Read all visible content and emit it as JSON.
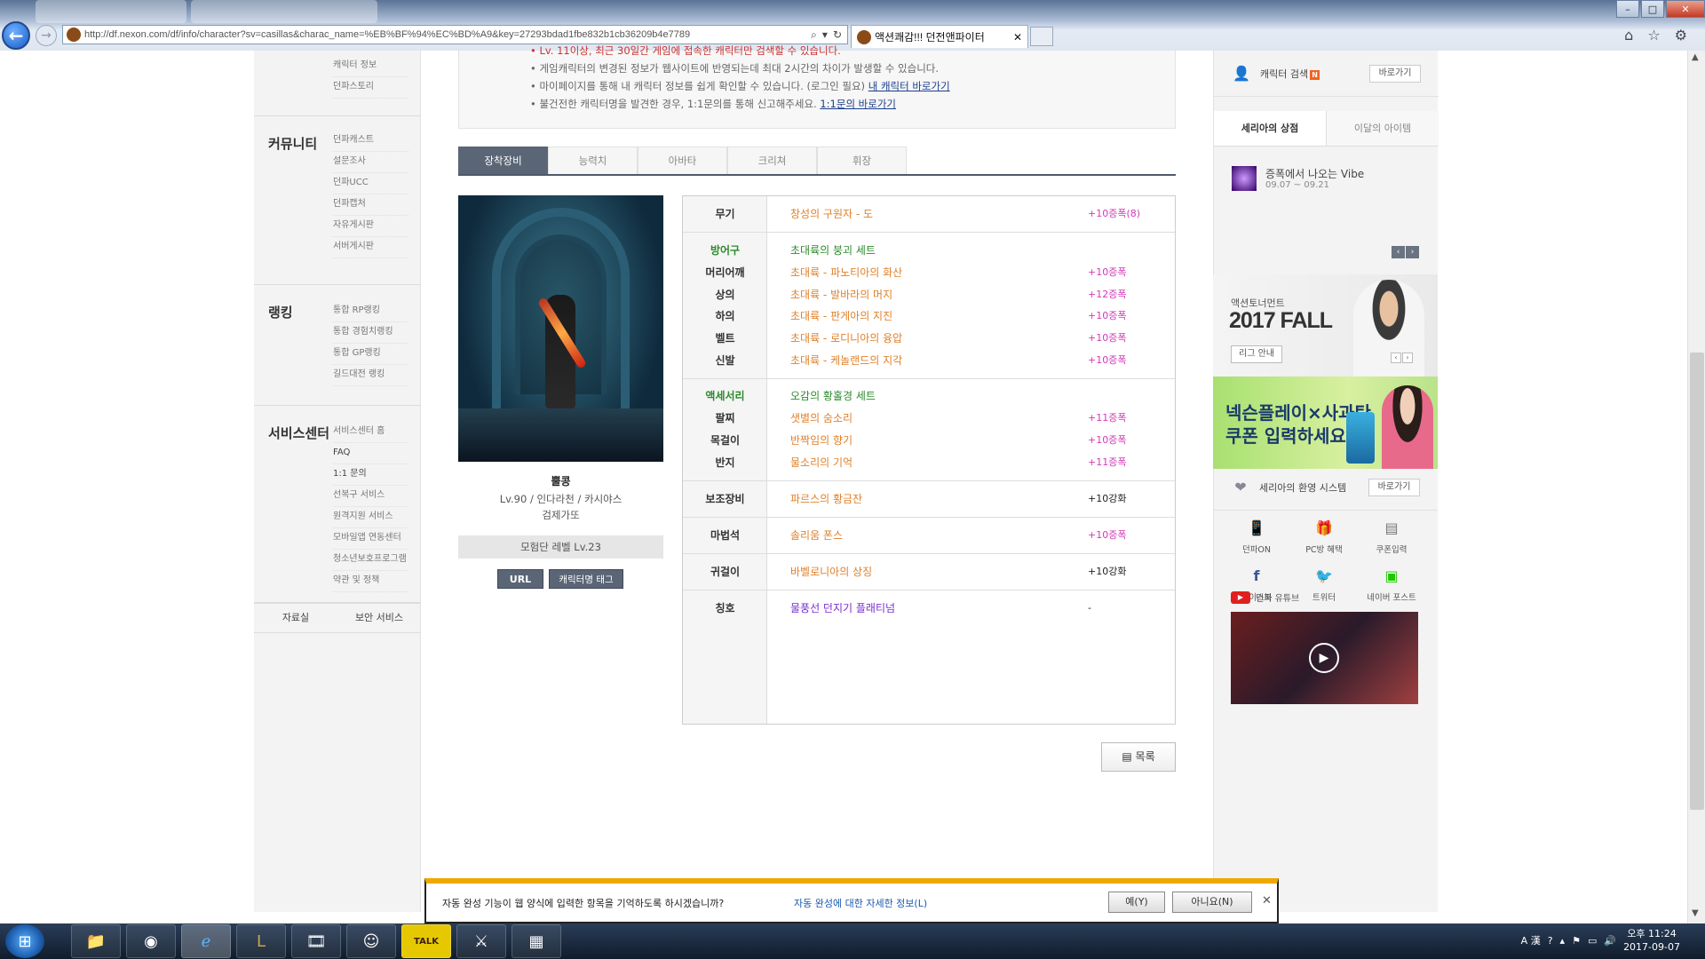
{
  "browser": {
    "url": "http://df.nexon.com/df/info/character?sv=casillas&charac_name=%EB%BF%94%EC%BD%A9&key=27293bdad1fbe832b1cb36209b4e7789",
    "tab_title": "액션쾌감!!! 던전앤파이터"
  },
  "lnb": {
    "top_links": [
      "캐릭터 정보",
      "던파스토리"
    ],
    "community": {
      "title": "커뮤니티",
      "links": [
        "던파캐스트",
        "설문조사",
        "던파UCC",
        "던파캡처",
        "자유게시판",
        "서버게시판"
      ]
    },
    "ranking": {
      "title": "랭킹",
      "links": [
        "통합 RP랭킹",
        "통합 경험치랭킹",
        "통합 GP랭킹",
        "길드대전 랭킹"
      ]
    },
    "service": {
      "title": "서비스센터",
      "links": [
        "서비스센터 홈",
        "FAQ",
        "1:1 문의",
        "선복구 서비스",
        "원격지원 서비스",
        "모바일앱 연동센터",
        "청소년보호프로그램",
        "약관 및 정책"
      ]
    },
    "bottom": [
      "자료실",
      "보안 서비스"
    ]
  },
  "notice": {
    "line0": "Lv. 11이상, 최근 30일간 게임에 접속한 캐릭터만 검색할 수 있습니다.",
    "line1": "게임캐릭터의 변경된 정보가 웹사이트에 반영되는데 최대 2시간의 차이가 발생할 수 있습니다.",
    "line2_text": "마이페이지를 통해 내 캐릭터 정보를 쉽게 확인할 수 있습니다. (로그인 필요)",
    "line2_link": "내 캐릭터 바로가기",
    "line3_text": "불건전한 캐릭터명을 발견한 경우, 1:1문의를 통해 신고해주세요.",
    "line3_link": "1:1문의 바로가기"
  },
  "tabs": [
    "장착장비",
    "능력치",
    "아바타",
    "크리쳐",
    "휘장"
  ],
  "character": {
    "name": "뿔콩",
    "info": "Lv.90 / 인다라천 / 카시야스",
    "guild": "검제가또",
    "adventure_level": "모험단 레벨 Lv.23",
    "url_button": "URL",
    "tag_button": "캐릭터명 태그"
  },
  "equipment": {
    "weapon": {
      "slot": "무기",
      "item": "창성의 구원자 - 도",
      "reinforce": "+10증폭(8)"
    },
    "armor_set": {
      "slot": "방어구",
      "item": "초대륙의 붕괴 세트"
    },
    "armor": [
      {
        "slot": "머리어깨",
        "item": "초대륙 - 파노티아의 화산",
        "reinforce": "+10증폭"
      },
      {
        "slot": "상의",
        "item": "초대륙 - 발바라의 머지",
        "reinforce": "+12증폭"
      },
      {
        "slot": "하의",
        "item": "초대륙 - 판게아의 지진",
        "reinforce": "+10증폭"
      },
      {
        "slot": "벨트",
        "item": "초대륙 - 로디니아의 융압",
        "reinforce": "+10증폭"
      },
      {
        "slot": "신발",
        "item": "초대륙 - 케놀랜드의 지각",
        "reinforce": "+10증폭"
      }
    ],
    "accessory_set": {
      "slot": "액세서리",
      "item": "오감의 황홀경 세트"
    },
    "accessories": [
      {
        "slot": "팔찌",
        "item": "샛별의 숨소리",
        "reinforce": "+11증폭"
      },
      {
        "slot": "목걸이",
        "item": "반짝임의 향기",
        "reinforce": "+10증폭"
      },
      {
        "slot": "반지",
        "item": "물소리의 기억",
        "reinforce": "+11증폭"
      }
    ],
    "sub": {
      "slot": "보조장비",
      "item": "파르스의 황금잔",
      "reinforce": "+10강화"
    },
    "stone": {
      "slot": "마법석",
      "item": "솔리움 폰스",
      "reinforce": "+10증폭"
    },
    "earring": {
      "slot": "귀걸이",
      "item": "바벨로니아의 상징",
      "reinforce": "+10강화"
    },
    "title": {
      "slot": "칭호",
      "item": "물풍선 던지기 플래티넘",
      "reinforce": "-"
    }
  },
  "list_button": "목록",
  "sidebar": {
    "char_search": "캐릭터 검색",
    "go": "바로가기",
    "shop_tabs": [
      "세리아의 상점",
      "이달의 아이템"
    ],
    "shop_item_name": "증폭에서 나오는 Vibe",
    "shop_item_date": "09.07 ~ 09.21",
    "banner1_small": "액션토너먼트",
    "banner1_big": "2017 FALL",
    "banner1_btn": "리그 안내",
    "banner2_line1": "넥슨플레이×사과탄",
    "banner2_line2": "쿠폰 입력하세요!",
    "seria_system": "세리아의 환영 시스템",
    "quick": [
      "던파ON",
      "PC방 혜택",
      "쿠폰입력",
      "페이스북",
      "트위터",
      "네이버 포스트"
    ],
    "youtube": "던파 유튜브"
  },
  "autocomplete": {
    "message": "자동 완성 기능이 웹 양식에 입력한 항목을 기억하도록 하시겠습니까?",
    "more": "자동 완성에 대한 자세한 정보(L)",
    "yes": "예(Y)",
    "no": "아니요(N)"
  },
  "taskbar": {
    "time": "오후 11:24",
    "date": "2017-09-07"
  }
}
